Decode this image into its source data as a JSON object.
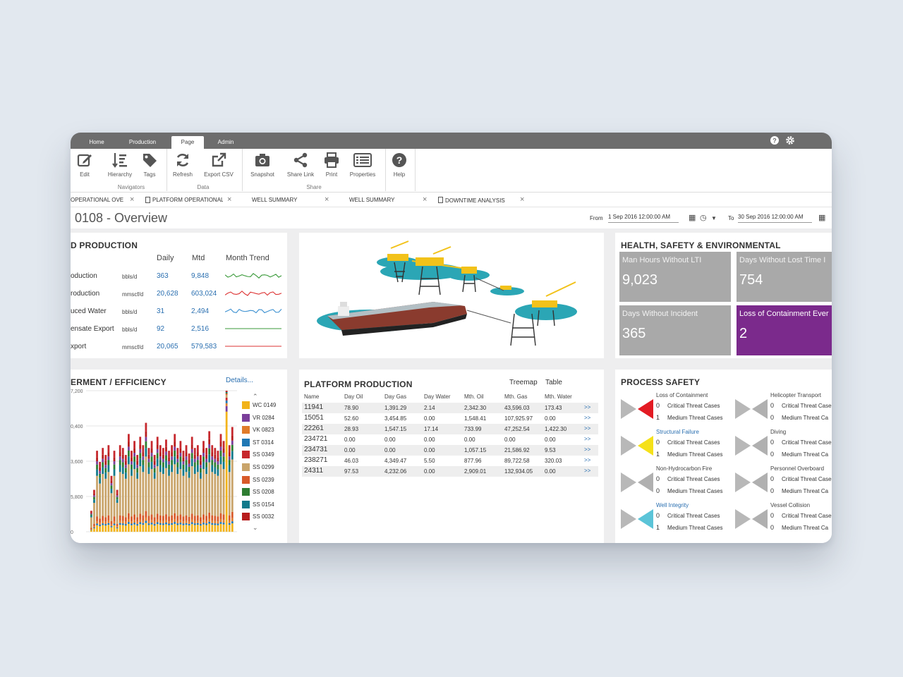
{
  "menu_tabs": [
    "Home",
    "Production",
    "Page",
    "Admin"
  ],
  "ribbon": {
    "buttons": [
      {
        "label": "Edit",
        "icon": "edit-icon"
      },
      {
        "label": "Hierarchy",
        "icon": "hierarchy-icon"
      },
      {
        "label": "Tags",
        "icon": "tag-icon"
      },
      {
        "label": "Refresh",
        "icon": "refresh-icon"
      },
      {
        "label": "Export CSV",
        "icon": "export-icon"
      },
      {
        "label": "Snapshot",
        "icon": "camera-icon"
      },
      {
        "label": "Share Link",
        "icon": "share-icon"
      },
      {
        "label": "Print",
        "icon": "print-icon"
      },
      {
        "label": "Properties",
        "icon": "properties-icon"
      },
      {
        "label": "Help",
        "icon": "help-icon"
      }
    ],
    "groups": [
      "Navigators",
      "Data",
      "Share"
    ]
  },
  "doc_tabs": [
    "OPERATIONAL OVE",
    "PLATFORM OPERATIONAL",
    "WELL SUMMARY",
    "WELL SUMMARY",
    "DOWNTIME ANALYSIS"
  ],
  "page_title": "0108 - Overview",
  "date_range": {
    "from_label": "From",
    "from": "1 Sep 2016 12:00:00 AM",
    "to_label": "To",
    "to": "30 Sep 2016 12:00:00 AM"
  },
  "production": {
    "title": "D PRODUCTION",
    "headers": [
      "Daily",
      "Mtd",
      "Month Trend"
    ],
    "rows": [
      {
        "name": "oduction",
        "unit": "bbls/d",
        "daily": "363",
        "mtd": "9,848"
      },
      {
        "name": "roduction",
        "unit": "mmscf/d",
        "daily": "20,628",
        "mtd": "603,024"
      },
      {
        "name": "uced Water",
        "unit": "bbls/d",
        "daily": "31",
        "mtd": "2,494"
      },
      {
        "name": "ensate Export",
        "unit": "bbls/d",
        "daily": "92",
        "mtd": "2,516"
      },
      {
        "name": "xport",
        "unit": "mmscf/d",
        "daily": "20,065",
        "mtd": "579,583"
      }
    ],
    "trend_colors": [
      "#3a9a3a",
      "#d33",
      "#3a8fd0",
      "#3a9a3a",
      "#d33"
    ]
  },
  "hse": {
    "title": "HEALTH, SAFETY & ENVIRONMENTAL",
    "tiles": [
      {
        "label": "Man Hours Without LTI",
        "value": "9,023",
        "color": "#a9a9a9"
      },
      {
        "label": "Days Without Lost Time I",
        "value": "754",
        "color": "#a9a9a9"
      },
      {
        "label": "Days Without Incident",
        "value": "365",
        "color": "#a9a9a9"
      },
      {
        "label": "Loss of Containment Ever",
        "value": "2",
        "color": "#7b2a8c"
      }
    ]
  },
  "efficiency": {
    "title": "ERMENT / EFFICIENCY",
    "details": "Details..."
  },
  "chart_data": {
    "type": "bar",
    "ytick_labels": [
      "7,200",
      "0,400",
      "3,600",
      "5,800",
      "0"
    ],
    "legend": [
      {
        "name": "WC 0149",
        "color": "#f2b31a"
      },
      {
        "name": "VR 0284",
        "color": "#7a3e9a"
      },
      {
        "name": "VK 0823",
        "color": "#e07b2a"
      },
      {
        "name": "ST 0314",
        "color": "#1f77b4"
      },
      {
        "name": "SS 0349",
        "color": "#c6282d"
      },
      {
        "name": "SS 0299",
        "color": "#c9a46a"
      },
      {
        "name": "SS 0239",
        "color": "#d85a2a"
      },
      {
        "name": "SS 0208",
        "color": "#2e7d32"
      },
      {
        "name": "SS 0154",
        "color": "#117a8b"
      },
      {
        "name": "SS 0032",
        "color": "#b71c1c"
      }
    ],
    "values": [
      0.15,
      0.3,
      0.58,
      0.5,
      0.6,
      0.55,
      0.62,
      0.4,
      0.58,
      0.3,
      0.62,
      0.6,
      0.55,
      0.7,
      0.58,
      0.65,
      0.55,
      0.68,
      0.62,
      0.78,
      0.6,
      0.65,
      0.55,
      0.68,
      0.62,
      0.6,
      0.66,
      0.58,
      0.62,
      0.7,
      0.6,
      0.65,
      0.58,
      0.62,
      0.56,
      0.68,
      0.6,
      0.62,
      0.55,
      0.65,
      0.6,
      0.72,
      0.62,
      0.6,
      0.58,
      0.7,
      0.65,
      1.0,
      0.62,
      0.75
    ]
  },
  "platform_production": {
    "title": "PLATFORM PRODUCTION",
    "views": [
      "Treemap",
      "Table"
    ],
    "columns": [
      "Name",
      "Day Oil",
      "Day Gas",
      "Day Water",
      "Mth. Oil",
      "Mth. Gas",
      "Mth. Water"
    ],
    "rows": [
      [
        "11941",
        "78.90",
        "1,391.29",
        "2.14",
        "2,342.30",
        "43,596.03",
        "173.43"
      ],
      [
        "15051",
        "52.60",
        "3,454.85",
        "0.00",
        "1,548.41",
        "107,925.97",
        "0.00"
      ],
      [
        "22261",
        "28.93",
        "1,547.15",
        "17.14",
        "733.99",
        "47,252.54",
        "1,422.30"
      ],
      [
        "234721",
        "0.00",
        "0.00",
        "0.00",
        "0.00",
        "0.00",
        "0.00"
      ],
      [
        "234731",
        "0.00",
        "0.00",
        "0.00",
        "1,057.15",
        "21,586.92",
        "9.53"
      ],
      [
        "238271",
        "46.03",
        "4,349.47",
        "5.50",
        "877.96",
        "89,722.58",
        "320.03"
      ],
      [
        "24311",
        "97.53",
        "4,232.06",
        "0.00",
        "2,909.01",
        "132,934.05",
        "0.00"
      ]
    ],
    "more": ">>"
  },
  "process_safety": {
    "title": "PROCESS SAFETY",
    "critical_label": "Critical Threat Cases",
    "medium_label": "Medium Threat Cases",
    "critical_label_short": "Critical Threat Case",
    "medium_label_short": "Medium Threat Ca",
    "items": [
      {
        "name": "Loss of Containment",
        "critical": "0",
        "medium": "1",
        "color": "#e31b23",
        "link": false
      },
      {
        "name": "Helicopter Transport",
        "critical": "0",
        "medium": "0",
        "color": "#b0b0b0",
        "link": false
      },
      {
        "name": "Structural Failure",
        "critical": "0",
        "medium": "1",
        "color": "#f5e11a",
        "link": true
      },
      {
        "name": "Diving",
        "critical": "0",
        "medium": "0",
        "color": "#b0b0b0",
        "link": false
      },
      {
        "name": "Non-Hydrocarbon Fire",
        "critical": "0",
        "medium": "0",
        "color": "#b0b0b0",
        "link": false
      },
      {
        "name": "Personnel Overboard",
        "critical": "0",
        "medium": "0",
        "color": "#b0b0b0",
        "link": false
      },
      {
        "name": "Well Integrity",
        "critical": "0",
        "medium": "1",
        "color": "#5bc4d8",
        "link": true
      },
      {
        "name": "Vessel Collision",
        "critical": "0",
        "medium": "0",
        "color": "#b0b0b0",
        "link": false
      }
    ]
  }
}
